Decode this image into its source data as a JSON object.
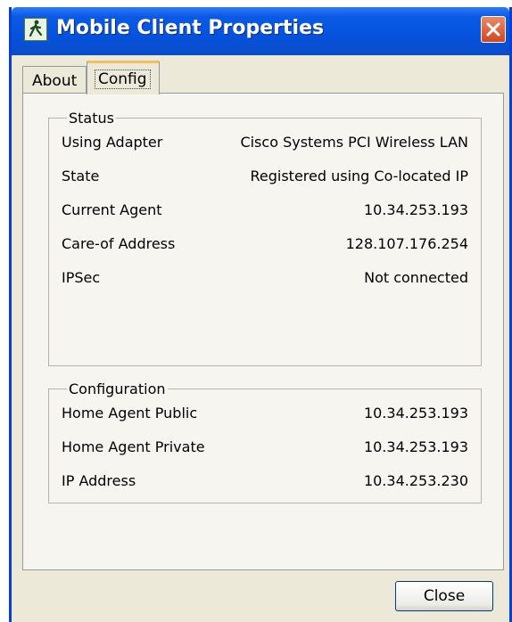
{
  "window": {
    "title": "Mobile Client Properties",
    "titlebar_color": "#0a5ae6"
  },
  "icons": {
    "app": "walking-person-icon",
    "close": "close-icon"
  },
  "tabs": [
    {
      "label": "About",
      "selected": false
    },
    {
      "label": "Config",
      "selected": true
    }
  ],
  "status": {
    "legend": "Status",
    "rows": [
      {
        "key": "Using Adapter",
        "value": "Cisco Systems PCI Wireless LAN"
      },
      {
        "key": "State",
        "value": "Registered using Co-located IP"
      },
      {
        "key": "Current Agent",
        "value": "10.34.253.193"
      },
      {
        "key": "Care-of Address",
        "value": "128.107.176.254"
      },
      {
        "key": "IPSec",
        "value": "Not connected"
      }
    ]
  },
  "configuration": {
    "legend": "Configuration",
    "rows": [
      {
        "key": "Home Agent Public",
        "value": "10.34.253.193"
      },
      {
        "key": "Home Agent Private",
        "value": "10.34.253.193"
      },
      {
        "key": "IP Address",
        "value": "10.34.253.230"
      }
    ]
  },
  "buttons": {
    "close_label": "Close"
  }
}
